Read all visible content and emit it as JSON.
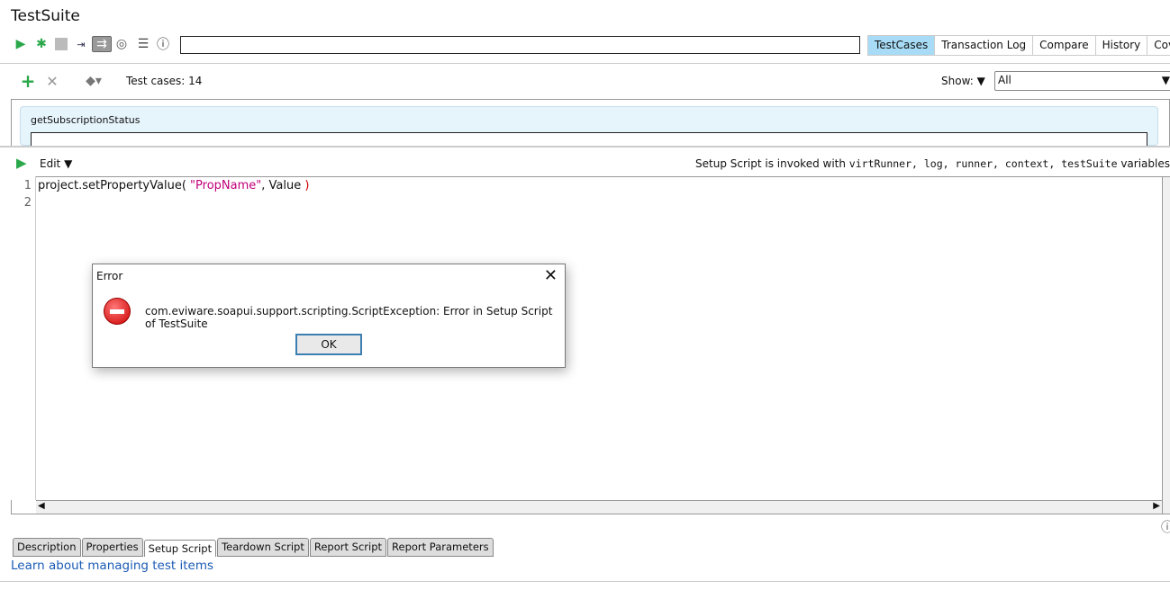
{
  "title": "TestSuite",
  "toolbar": {
    "search_value": "",
    "tabs": [
      "TestCases",
      "Transaction Log",
      "Compare",
      "History",
      "Coverage"
    ]
  },
  "testcases": {
    "count_label": "Test cases: 14",
    "show_label": "Show:",
    "show_value": "All",
    "selected_case": "getSubscriptionStatus"
  },
  "editor": {
    "edit_label": "Edit",
    "info_prefix": "Setup Script is invoked with ",
    "info_vars": "virtRunner, log, runner, context, testSuite",
    "info_suffix": " variables",
    "line_numbers": [
      "1",
      "2"
    ],
    "code": {
      "fn": "project.setPropertyValue(",
      "str": " \"PropName\"",
      "rest": ", Value ",
      "close": ")"
    }
  },
  "bottom_tabs": [
    "Description",
    "Properties",
    "Setup Script",
    "Teardown Script",
    "Report Script",
    "Report Parameters"
  ],
  "learn_link": "Learn about managing test items",
  "dialog": {
    "title": "Error",
    "message": "com.eviware.soapui.support.scripting.ScriptException: Error in Setup Script of TestSuite",
    "ok": "OK"
  }
}
